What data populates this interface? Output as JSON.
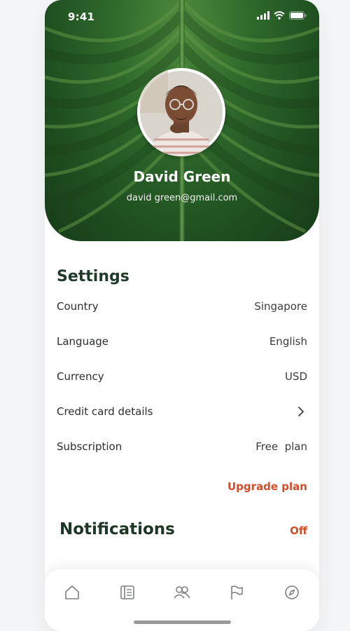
{
  "status_bar": {
    "time": "9:41"
  },
  "profile": {
    "name": "David Green",
    "email": "david green@gmail.com"
  },
  "settings": {
    "title": "Settings",
    "rows": [
      {
        "label": "Country",
        "value": "Singapore"
      },
      {
        "label": "Language",
        "value": "English"
      },
      {
        "label": "Currency",
        "value": "USD"
      },
      {
        "label": "Credit card details",
        "value": ""
      },
      {
        "label": "Subscription",
        "value": "Free  plan"
      }
    ],
    "upgrade_label": "Upgrade plan"
  },
  "notifications": {
    "title": "Notifications",
    "value": "Off"
  },
  "tabbar": {
    "icons": [
      "home-icon",
      "book-icon",
      "people-icon",
      "flag-icon",
      "compass-icon"
    ]
  },
  "colors": {
    "accent": "#d24d2a",
    "title": "#223a2a",
    "leaf": "#2f6a2b"
  }
}
